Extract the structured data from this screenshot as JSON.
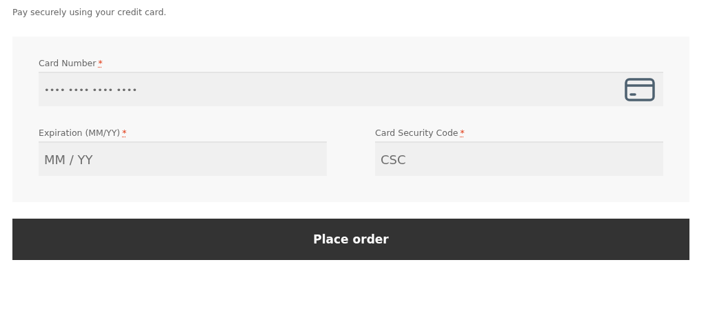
{
  "intro": "Pay securely using your credit card.",
  "rows": [
    [
      {
        "label": "Card Number",
        "required": true,
        "required_mark": "*",
        "placeholder": "•••• •••• •••• ••••",
        "kind": "card"
      }
    ],
    [
      {
        "label": "Expiration (MM/YY)",
        "required": true,
        "required_mark": "*",
        "placeholder": "MM / YY",
        "kind": "text"
      },
      {
        "label": "Card Security Code",
        "required": true,
        "required_mark": "*",
        "placeholder": "CSC",
        "kind": "text"
      }
    ]
  ],
  "button": "Place order"
}
